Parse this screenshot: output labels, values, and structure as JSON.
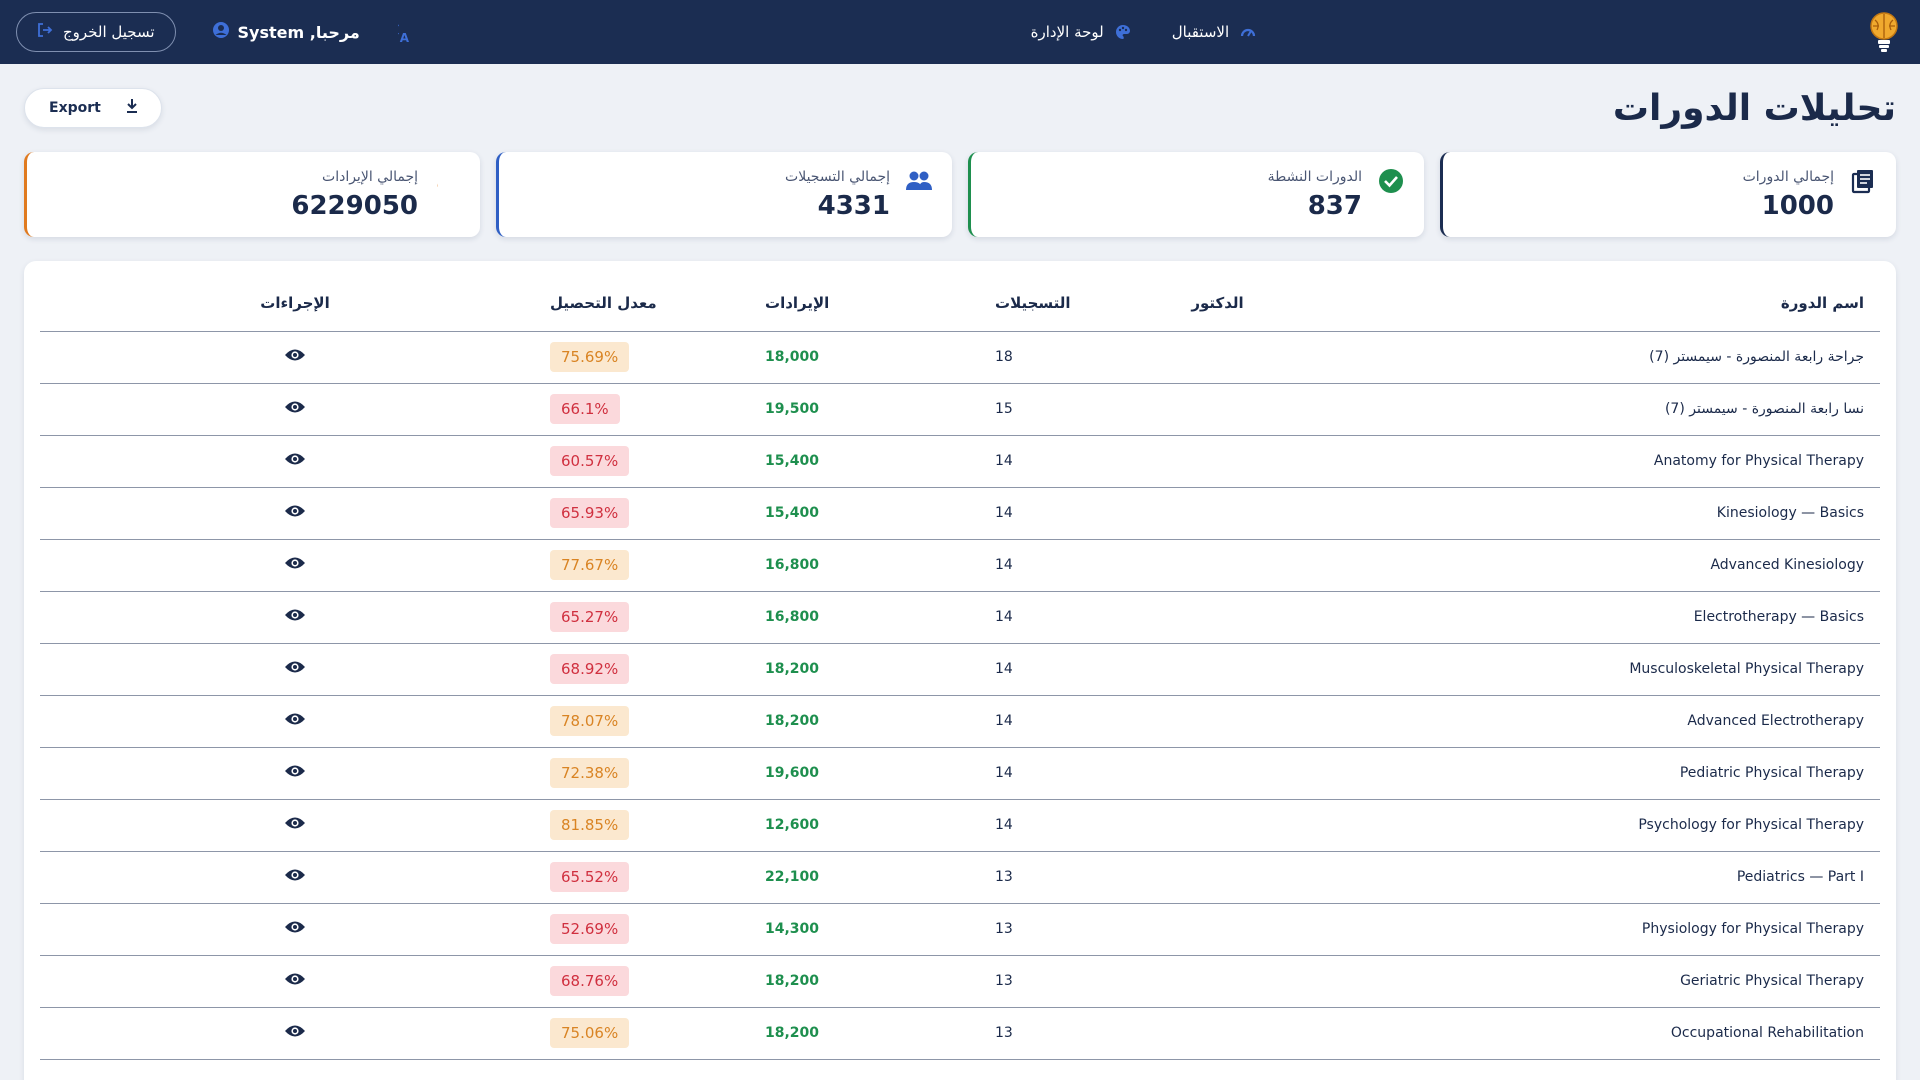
{
  "topbar": {
    "nav_home": "الاستقبال",
    "nav_dashboard": "لوحة الإدارة",
    "welcome": "مرحبا, System",
    "logout": "تسجيل الخروج"
  },
  "page": {
    "title": "تحليلات الدورات",
    "export": "Export"
  },
  "stats": [
    {
      "label": "إجمالي الدورات",
      "value": "1000",
      "icon": "courses-icon",
      "color": "#1b2d52"
    },
    {
      "label": "الدورات النشطة",
      "value": "837",
      "icon": "check-circle-icon",
      "color": "#1e8f4e"
    },
    {
      "label": "إجمالي التسجيلات",
      "value": "4331",
      "icon": "people-icon",
      "color": "#2f5fc4"
    },
    {
      "label": "إجمالي الإيرادات",
      "value": "6229050",
      "icon": "dollar-icon",
      "color": "#e07a1f"
    }
  ],
  "table": {
    "headers": {
      "name": "اسم الدورة",
      "doctor": "الدكتور",
      "enrollments": "التسجيلات",
      "revenue": "الإيرادات",
      "rate": "معدل التحصيل",
      "actions": "الإجراءات"
    },
    "rows": [
      {
        "name": "جراحة رابعة المنصورة - سيمستر (7)",
        "doctor": "",
        "enrollments": "18",
        "revenue": "18,000",
        "rate": "75.69%",
        "level": "mid"
      },
      {
        "name": "نسا رابعة المنصورة - سيمستر (7)",
        "doctor": "",
        "enrollments": "15",
        "revenue": "19,500",
        "rate": "66.1%",
        "level": "low"
      },
      {
        "name": "Anatomy for Physical Therapy",
        "doctor": "",
        "enrollments": "14",
        "revenue": "15,400",
        "rate": "60.57%",
        "level": "low"
      },
      {
        "name": "Kinesiology — Basics",
        "doctor": "",
        "enrollments": "14",
        "revenue": "15,400",
        "rate": "65.93%",
        "level": "low"
      },
      {
        "name": "Advanced Kinesiology",
        "doctor": "",
        "enrollments": "14",
        "revenue": "16,800",
        "rate": "77.67%",
        "level": "mid"
      },
      {
        "name": "Electrotherapy — Basics",
        "doctor": "",
        "enrollments": "14",
        "revenue": "16,800",
        "rate": "65.27%",
        "level": "low"
      },
      {
        "name": "Musculoskeletal Physical Therapy",
        "doctor": "",
        "enrollments": "14",
        "revenue": "18,200",
        "rate": "68.92%",
        "level": "low"
      },
      {
        "name": "Advanced Electrotherapy",
        "doctor": "",
        "enrollments": "14",
        "revenue": "18,200",
        "rate": "78.07%",
        "level": "mid"
      },
      {
        "name": "Pediatric Physical Therapy",
        "doctor": "",
        "enrollments": "14",
        "revenue": "19,600",
        "rate": "72.38%",
        "level": "mid"
      },
      {
        "name": "Psychology for Physical Therapy",
        "doctor": "",
        "enrollments": "14",
        "revenue": "12,600",
        "rate": "81.85%",
        "level": "mid"
      },
      {
        "name": "Pediatrics — Part I",
        "doctor": "",
        "enrollments": "13",
        "revenue": "22,100",
        "rate": "65.52%",
        "level": "low"
      },
      {
        "name": "Physiology for Physical Therapy",
        "doctor": "",
        "enrollments": "13",
        "revenue": "14,300",
        "rate": "52.69%",
        "level": "low"
      },
      {
        "name": "Geriatric Physical Therapy",
        "doctor": "",
        "enrollments": "13",
        "revenue": "18,200",
        "rate": "68.76%",
        "level": "low"
      },
      {
        "name": "Occupational Rehabilitation",
        "doctor": "",
        "enrollments": "13",
        "revenue": "18,200",
        "rate": "75.06%",
        "level": "mid"
      }
    ]
  },
  "colors": {
    "navbar": "#1b2d52",
    "revenue_text": "#1e8f4e",
    "rate_mid_bg": "#fbe8cf",
    "rate_mid_text": "#d98424",
    "rate_low_bg": "#fbd9dc",
    "rate_low_text": "#d0303f"
  }
}
